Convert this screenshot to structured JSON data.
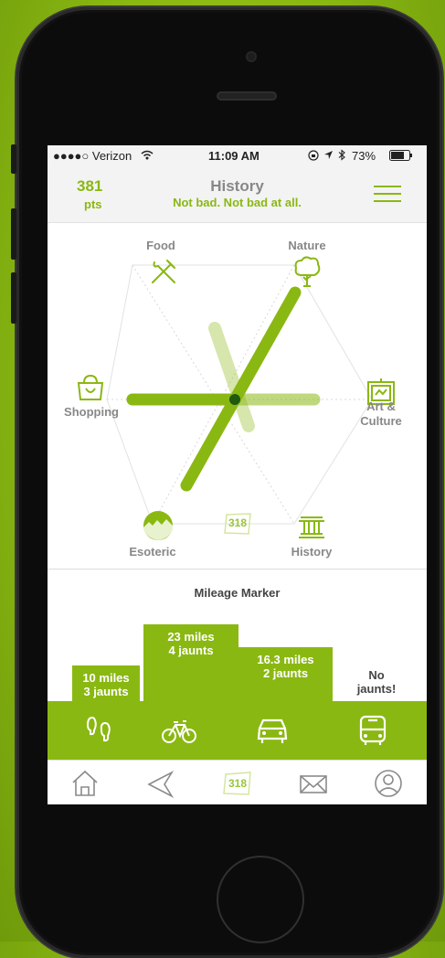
{
  "status_bar": {
    "carrier": "●●●●○ Verizon",
    "time": "11:09 AM",
    "battery": "73%",
    "icons": [
      "wifi-icon",
      "lock-rotation-icon",
      "location-icon",
      "bluetooth-icon",
      "battery-icon"
    ]
  },
  "header": {
    "points": "381",
    "points_unit": "pts",
    "title": "History",
    "subtitle": "Not bad. Not bad at all.",
    "menu_icon": "hamburger-menu-icon"
  },
  "radar": {
    "categories": [
      {
        "label": "Food",
        "icon": "fork-knife-icon"
      },
      {
        "label": "Nature",
        "icon": "tree-icon"
      },
      {
        "label": "Shopping",
        "icon": "shopping-bag-icon"
      },
      {
        "label": "Art & Culture",
        "icon": "framed-picture-icon"
      },
      {
        "label": "Esoteric",
        "icon": "esoteric-circle-icon"
      },
      {
        "label": "History",
        "icon": "museum-icon"
      }
    ],
    "center_badge": "318"
  },
  "mileage": {
    "title": "Mileage Marker",
    "bars": [
      {
        "mode": "walk",
        "icon": "footprints-icon",
        "miles": "10 miles",
        "jaunts": "3 jaunts"
      },
      {
        "mode": "bike",
        "icon": "bicycle-icon",
        "miles": "23 miles",
        "jaunts": "4 jaunts"
      },
      {
        "mode": "car",
        "icon": "car-icon",
        "miles": "16.3 miles",
        "jaunts": "2 jaunts"
      },
      {
        "mode": "bus",
        "icon": "bus-icon",
        "miles": "No",
        "jaunts": "jaunts!"
      }
    ]
  },
  "colors": {
    "accent": "#8ab812",
    "label_gray": "#888888"
  },
  "tab_bar": {
    "tabs": [
      {
        "name": "home",
        "icon": "home-icon"
      },
      {
        "name": "explore",
        "icon": "compass-arrow-icon"
      },
      {
        "name": "badge",
        "icon": "badge-icon",
        "label": "318"
      },
      {
        "name": "messages",
        "icon": "envelope-icon"
      },
      {
        "name": "profile",
        "icon": "user-icon"
      }
    ]
  }
}
